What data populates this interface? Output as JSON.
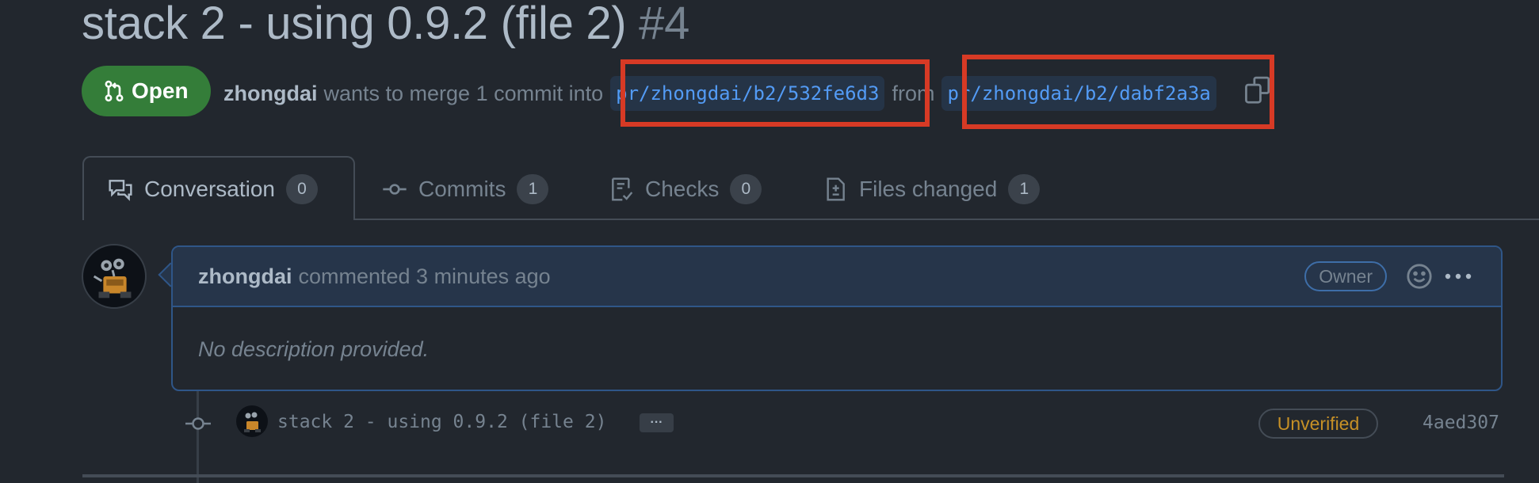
{
  "pr": {
    "title": "stack 2 - using 0.9.2 (file 2)",
    "number": "#4",
    "state": "Open",
    "author": "zhongdai",
    "merge_text_1": "wants to merge 1 commit into",
    "base_branch": "pr/zhongdai/b2/532fe6d3",
    "merge_text_2": "from",
    "head_branch": "pr/zhongdai/b2/dabf2a3a"
  },
  "tabs": [
    {
      "label": "Conversation",
      "count": "0",
      "icon": "comment-discussion-icon",
      "active": true
    },
    {
      "label": "Commits",
      "count": "1",
      "icon": "git-commit-icon",
      "active": false
    },
    {
      "label": "Checks",
      "count": "0",
      "icon": "checklist-icon",
      "active": false
    },
    {
      "label": "Files changed",
      "count": "1",
      "icon": "file-diff-icon",
      "active": false
    }
  ],
  "comment": {
    "author": "zhongdai",
    "action": "commented 3 minutes ago",
    "role": "Owner",
    "body": "No description provided."
  },
  "commit": {
    "message": "stack 2 - using 0.9.2 (file 2)",
    "ellipsis": "···",
    "verification": "Unverified",
    "sha": "4aed307"
  },
  "colors": {
    "background": "#22272e",
    "open_badge": "#347d39",
    "link": "#539bf5",
    "highlight": "#d73a25",
    "unverified": "#c69026"
  }
}
